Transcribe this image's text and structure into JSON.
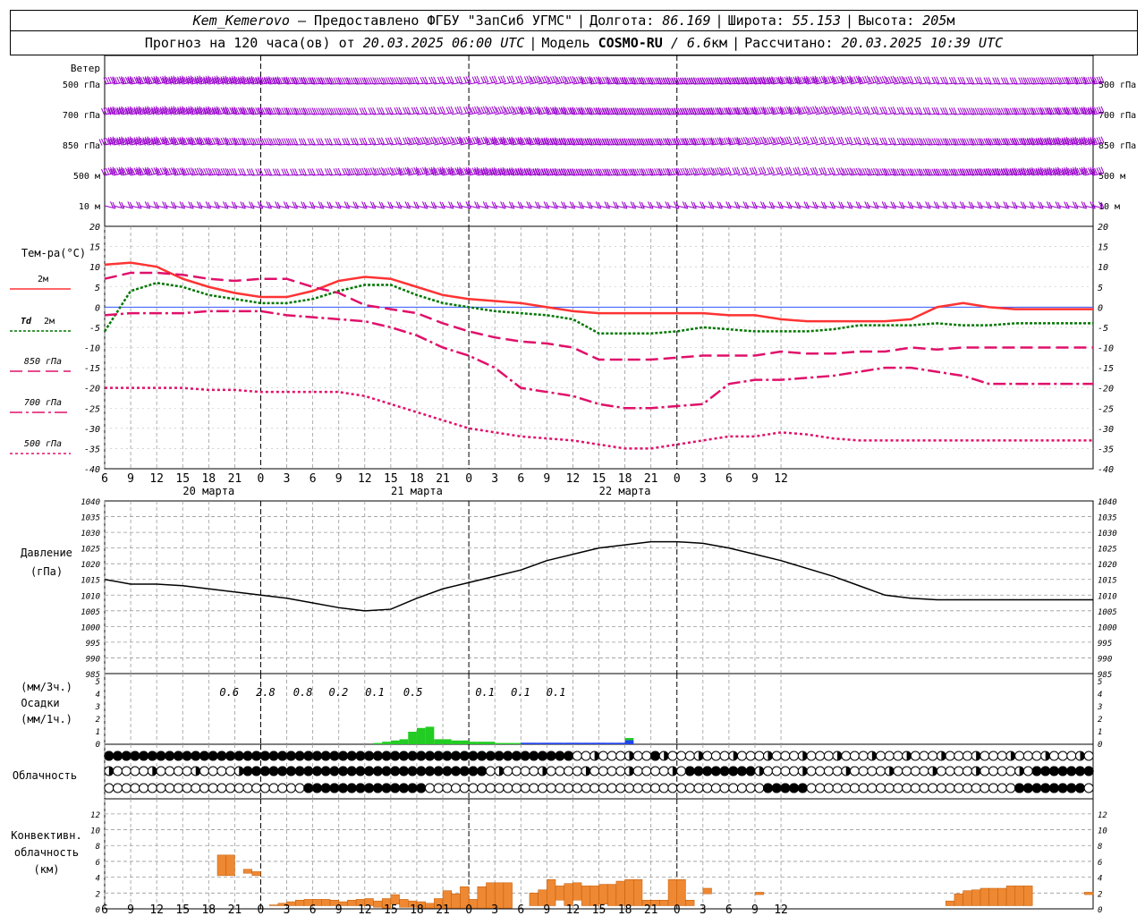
{
  "header": {
    "station": "Kem_Kemerovo",
    "provider": "— Предоставлено ФГБУ \"ЗапСиб УГМС\"",
    "lon_label": "Долгота:",
    "lon_value": "86.169",
    "lat_label": "Широта:",
    "lat_value": "55.153",
    "alt_label": "Высота:",
    "alt_value": "205",
    "alt_unit": "м",
    "forecast_label": "Прогноз на 120 часа(ов) от",
    "forecast_start": "20.03.2025 06:00 UTC",
    "model_label": "Модель",
    "model_name": "COSMO-RU",
    "model_res": "/ 6.6",
    "model_res_unit": "км",
    "calc_label": "Рассчитано:",
    "calc_time": "20.03.2025 10:39 UTC"
  },
  "colors": {
    "wind": "#9900cc",
    "t2m": "#ff3333",
    "td2m": "#007700",
    "t850": "#e0106a",
    "t700": "#e0106a",
    "t500": "#e0106a",
    "zero_line": "#3355ff",
    "pressure": "#000000",
    "precip_rain": "#22cc22",
    "precip_snow": "#2244ee",
    "convective": "#ee8833",
    "grid": "#999999"
  },
  "chart_data": [
    {
      "id": "wind",
      "type": "wind_barbs",
      "title": "Ветер",
      "levels": [
        "500 гПа",
        "700 гПа",
        "850 гПа",
        "500 м",
        "10 м"
      ],
      "time_ticks": [
        "6",
        "9",
        "12",
        "15",
        "18",
        "21",
        "0",
        "3",
        "6",
        "9",
        "12",
        "15",
        "18",
        "21",
        "0",
        "3",
        "6",
        "9",
        "12",
        "15",
        "18",
        "21",
        "0",
        "3",
        "6",
        "9",
        "12"
      ],
      "note": "barbs shown at hourly steps"
    },
    {
      "id": "temperature",
      "type": "line",
      "title": "Тем-ра(°C)",
      "x_hours": [
        0,
        3,
        6,
        9,
        12,
        15,
        18,
        21,
        24,
        27,
        30,
        33,
        36,
        39,
        42,
        45,
        48,
        51,
        54,
        57,
        60,
        63,
        66,
        69,
        72,
        75,
        78,
        81,
        84,
        87,
        90,
        93,
        96,
        99,
        102,
        105,
        108,
        111,
        114
      ],
      "ylim": [
        -40,
        20
      ],
      "yticks": [
        20,
        15,
        10,
        5,
        0,
        -5,
        -10,
        -15,
        -20,
        -25,
        -30,
        -35,
        -40
      ],
      "series": [
        {
          "name": "2м",
          "values": [
            10.5,
            11,
            10,
            7,
            5,
            3.5,
            2.5,
            2.5,
            4,
            6.5,
            7.5,
            7,
            5,
            3,
            2,
            1.5,
            1,
            0,
            -1,
            -1.5,
            -1.5,
            -1.5,
            -1.5,
            -1.5,
            -2,
            -2,
            -3,
            -3.5,
            -3.5,
            -3.5,
            -3.5,
            -3,
            0,
            1,
            0,
            -0.5,
            -0.5,
            -0.5,
            -0.5
          ]
        },
        {
          "name": "Td 2м",
          "values": [
            -6,
            4,
            6,
            5,
            3,
            2,
            1,
            1,
            2,
            4,
            5.5,
            5.5,
            3,
            1,
            0,
            -1,
            -1.5,
            -2,
            -3,
            -6.5,
            -6.5,
            -6.5,
            -6,
            -5,
            -5.5,
            -6,
            -6,
            -6,
            -5.5,
            -4.5,
            -4.5,
            -4.5,
            -4,
            -4.5,
            -4.5,
            -4,
            -4,
            -4,
            -4
          ]
        },
        {
          "name": "850 гПа",
          "values": [
            7,
            8.5,
            8.5,
            8,
            7,
            6.5,
            7,
            7,
            5,
            3.5,
            0.5,
            -0.5,
            -1.5,
            -4,
            -6,
            -7.5,
            -8.5,
            -9,
            -10,
            -13,
            -13,
            -13,
            -12.5,
            -12,
            -12,
            -12,
            -11,
            -11.5,
            -11.5,
            -11,
            -11,
            -10,
            -10.5,
            -10,
            -10,
            -10,
            -10,
            -10,
            -10
          ]
        },
        {
          "name": "700 гПа",
          "values": [
            -2,
            -1.5,
            -1.5,
            -1.5,
            -1,
            -1,
            -1,
            -2,
            -2.5,
            -3,
            -3.5,
            -5,
            -7,
            -10,
            -12,
            -15,
            -20,
            -21,
            -22,
            -24,
            -25,
            -25,
            -24.5,
            -24,
            -19,
            -18,
            -18,
            -17.5,
            -17,
            -16,
            -15,
            -15,
            -16,
            -17,
            -19,
            -19,
            -19,
            -19,
            -19
          ]
        },
        {
          "name": "500 гПа",
          "values": [
            -20,
            -20,
            -20,
            -20,
            -20.5,
            -20.5,
            -21,
            -21,
            -21,
            -21,
            -22,
            -24,
            -26,
            -28,
            -30,
            -31,
            -32,
            -32.5,
            -33,
            -34,
            -35,
            -35,
            -34,
            -33,
            -32,
            -32,
            -31,
            -31.5,
            -32.5,
            -33,
            -33,
            -33,
            -33,
            -33,
            -33,
            -33,
            -33,
            -33,
            -33
          ]
        }
      ]
    },
    {
      "id": "pressure",
      "type": "line",
      "title": "Давление",
      "ylabel": "(гПа)",
      "x_hours": [
        0,
        3,
        6,
        9,
        12,
        15,
        18,
        21,
        24,
        27,
        30,
        33,
        36,
        39,
        42,
        45,
        48,
        51,
        54,
        57,
        60,
        63,
        66,
        69,
        72,
        75,
        78,
        81,
        84,
        87,
        90,
        93,
        96,
        99,
        102,
        105,
        108,
        111,
        114
      ],
      "ylim": [
        985,
        1040
      ],
      "yticks": [
        1040,
        1035,
        1030,
        1025,
        1020,
        1015,
        1010,
        1005,
        1000,
        995,
        990,
        985
      ],
      "series": [
        {
          "name": "p",
          "values": [
            1015,
            1013.5,
            1013.5,
            1013,
            1012,
            1011,
            1010,
            1009,
            1007.5,
            1006,
            1005,
            1005.5,
            1009,
            1012,
            1014,
            1016,
            1018,
            1021,
            1023,
            1025,
            1026,
            1027,
            1027,
            1026.5,
            1025,
            1023,
            1021,
            1018.5,
            1016,
            1013,
            1010,
            1009,
            1008.5,
            1008.5,
            1008.5,
            1008.5,
            1008.5,
            1008.5,
            1008.5
          ]
        }
      ]
    },
    {
      "id": "precip",
      "type": "bar",
      "title": "Осадки",
      "ylabel_top": "(мм/3ч.)",
      "ylabel_bottom": "(мм/1ч.)",
      "yticks": [
        "5",
        "4",
        "3",
        "2",
        "1",
        "0"
      ],
      "totals_3h": [
        "0.6",
        "2.8",
        "0.8",
        "0.2",
        "0.1",
        "0.5",
        "0.1",
        "0.1",
        "0.1"
      ],
      "ylim": [
        0,
        5
      ],
      "rain_mm_per_hour": [
        0,
        0,
        0,
        0,
        0,
        0,
        0,
        0,
        0,
        0,
        0,
        0,
        0,
        0,
        0,
        0,
        0,
        0,
        0,
        0,
        0,
        0,
        0,
        0,
        0,
        0,
        0,
        0,
        0,
        0,
        0,
        0.1,
        0.2,
        0.3,
        0.4,
        1.0,
        1.3,
        1.4,
        0.4,
        0.4,
        0.3,
        0.3,
        0.2,
        0.2,
        0.2,
        0.1,
        0.1,
        0.1,
        0.05,
        0.05,
        0.05,
        0.05,
        0,
        0,
        0,
        0,
        0,
        0,
        0,
        0,
        0.5
      ],
      "snow_mm_per_hour": [
        0,
        0,
        0,
        0,
        0,
        0,
        0,
        0,
        0,
        0,
        0,
        0,
        0,
        0,
        0,
        0,
        0,
        0,
        0,
        0,
        0,
        0,
        0,
        0,
        0,
        0,
        0,
        0,
        0,
        0,
        0,
        0,
        0,
        0,
        0,
        0,
        0,
        0,
        0,
        0,
        0,
        0,
        0,
        0,
        0,
        0,
        0,
        0,
        0.05,
        0.05,
        0.05,
        0.05,
        0.05,
        0.05,
        0.05,
        0.05,
        0.05,
        0.05,
        0.05,
        0.05,
        0.25
      ]
    },
    {
      "id": "clouds",
      "type": "symbols",
      "title": "Облачность",
      "rows": 3
    },
    {
      "id": "convective",
      "type": "bar",
      "title": "Конвективн.",
      "title2": "облачность",
      "ylabel": "(км)",
      "ylim": [
        0,
        13
      ],
      "yticks": [
        12,
        10,
        8,
        6,
        4,
        2,
        0
      ],
      "bars_km": [
        {
          "from": 13,
          "to": 14,
          "base": 4.2,
          "top": 6.8
        },
        {
          "from": 14,
          "to": 15,
          "base": 4.2,
          "top": 6.8
        },
        {
          "from": 16,
          "to": 17,
          "base": 4.5,
          "top": 5.0
        },
        {
          "from": 17,
          "to": 18,
          "base": 4.2,
          "top": 4.7
        },
        {
          "from": 19,
          "to": 20,
          "base": 0.4,
          "top": 0.5
        },
        {
          "from": 20,
          "to": 21,
          "base": 0.4,
          "top": 0.7
        },
        {
          "from": 21,
          "to": 22,
          "base": 0.4,
          "top": 0.9
        },
        {
          "from": 22,
          "to": 23,
          "base": 0.4,
          "top": 1.1
        },
        {
          "from": 23,
          "to": 24,
          "base": 0.4,
          "top": 1.2
        },
        {
          "from": 24,
          "to": 25,
          "base": 0.4,
          "top": 1.2
        },
        {
          "from": 25,
          "to": 26,
          "base": 0.4,
          "top": 1.2
        },
        {
          "from": 26,
          "to": 27,
          "base": 0.4,
          "top": 1.1
        },
        {
          "from": 27,
          "to": 28,
          "base": 0.4,
          "top": 0.9
        },
        {
          "from": 28,
          "to": 29,
          "base": 0.4,
          "top": 1.1
        },
        {
          "from": 29,
          "to": 30,
          "base": 0.4,
          "top": 1.2
        },
        {
          "from": 30,
          "to": 31,
          "base": 0.4,
          "top": 1.3
        },
        {
          "from": 31,
          "to": 32,
          "base": 0.2,
          "top": 1.0
        },
        {
          "from": 32,
          "to": 33,
          "base": 0.1,
          "top": 1.3
        },
        {
          "from": 33,
          "to": 34,
          "base": 0.6,
          "top": 1.8
        },
        {
          "from": 34,
          "to": 35,
          "base": 0.2,
          "top": 1.2
        },
        {
          "from": 35,
          "to": 36,
          "base": 0.2,
          "top": 1.0
        },
        {
          "from": 36,
          "to": 37,
          "base": 0.1,
          "top": 0.9
        },
        {
          "from": 37,
          "to": 38,
          "base": 0.1,
          "top": 0.7
        },
        {
          "from": 38,
          "to": 39,
          "base": 0.1,
          "top": 1.3
        },
        {
          "from": 39,
          "to": 40,
          "base": 0.1,
          "top": 2.3
        },
        {
          "from": 40,
          "to": 41,
          "base": 0.1,
          "top": 1.9
        },
        {
          "from": 41,
          "to": 42,
          "base": 0.1,
          "top": 2.8
        },
        {
          "from": 42,
          "to": 43,
          "base": 0.1,
          "top": 1.2
        },
        {
          "from": 43,
          "to": 44,
          "base": 0.1,
          "top": 2.8
        },
        {
          "from": 44,
          "to": 45,
          "base": 0.1,
          "top": 3.3
        },
        {
          "from": 45,
          "to": 46,
          "base": 0.1,
          "top": 3.3
        },
        {
          "from": 46,
          "to": 47,
          "base": 0.1,
          "top": 3.3
        },
        {
          "from": 49,
          "to": 50,
          "base": 0.4,
          "top": 2.0
        },
        {
          "from": 50,
          "to": 51,
          "base": 0.4,
          "top": 2.4
        },
        {
          "from": 51,
          "to": 52,
          "base": 0.4,
          "top": 3.7
        },
        {
          "from": 52,
          "to": 53,
          "base": 1.1,
          "top": 2.9
        },
        {
          "from": 53,
          "to": 54,
          "base": 0.4,
          "top": 3.2
        },
        {
          "from": 54,
          "to": 55,
          "base": 1.1,
          "top": 3.3
        },
        {
          "from": 55,
          "to": 56,
          "base": 0.4,
          "top": 2.9
        },
        {
          "from": 56,
          "to": 57,
          "base": 0.4,
          "top": 2.9
        },
        {
          "from": 57,
          "to": 58,
          "base": 0.6,
          "top": 3.1
        },
        {
          "from": 58,
          "to": 59,
          "base": 0.4,
          "top": 3.1
        },
        {
          "from": 59,
          "to": 60,
          "base": 0.4,
          "top": 3.5
        },
        {
          "from": 60,
          "to": 61,
          "base": 0.4,
          "top": 3.7
        },
        {
          "from": 61,
          "to": 62,
          "base": 0.4,
          "top": 3.7
        },
        {
          "from": 62,
          "to": 63,
          "base": 0.4,
          "top": 1.1
        },
        {
          "from": 63,
          "to": 64,
          "base": 0.4,
          "top": 1.1
        },
        {
          "from": 64,
          "to": 65,
          "base": 0.4,
          "top": 1.1
        },
        {
          "from": 65,
          "to": 66,
          "base": 0.4,
          "top": 3.7
        },
        {
          "from": 66,
          "to": 67,
          "base": 0.4,
          "top": 3.7
        },
        {
          "from": 67,
          "to": 68,
          "base": 0.4,
          "top": 1.1
        },
        {
          "from": 69,
          "to": 70,
          "base": 1.9,
          "top": 2.6
        },
        {
          "from": 75,
          "to": 76,
          "base": 1.8,
          "top": 2.1
        },
        {
          "from": 97,
          "to": 98,
          "base": 0.4,
          "top": 1.0
        },
        {
          "from": 98,
          "to": 99,
          "base": 0.4,
          "top": 1.9
        },
        {
          "from": 99,
          "to": 100,
          "base": 0.4,
          "top": 2.3
        },
        {
          "from": 100,
          "to": 101,
          "base": 0.4,
          "top": 2.4
        },
        {
          "from": 101,
          "to": 102,
          "base": 0.4,
          "top": 2.6
        },
        {
          "from": 102,
          "to": 103,
          "base": 0.4,
          "top": 2.6
        },
        {
          "from": 103,
          "to": 104,
          "base": 0.4,
          "top": 2.6
        },
        {
          "from": 104,
          "to": 105,
          "base": 0.4,
          "top": 2.9
        },
        {
          "from": 105,
          "to": 106,
          "base": 0.4,
          "top": 2.9
        },
        {
          "from": 106,
          "to": 107,
          "base": 0.4,
          "top": 2.9
        },
        {
          "from": 113,
          "to": 114,
          "base": 1.8,
          "top": 2.1
        }
      ]
    }
  ],
  "axis": {
    "hour_labels": [
      "6",
      "9",
      "12",
      "15",
      "18",
      "21",
      "0",
      "3",
      "6",
      "9",
      "12",
      "15",
      "18",
      "21",
      "0",
      "3",
      "6",
      "9",
      "12",
      "15",
      "18",
      "21",
      "0",
      "3",
      "6",
      "9",
      "12"
    ],
    "date_labels": [
      "20 марта",
      "21 марта",
      "22 марта"
    ]
  },
  "legend": {
    "t2m": "2м",
    "td_symbol": "Td",
    "td2m": "2м",
    "t850": "850 гПа",
    "t700": "700 гПа",
    "t500": "500 гПа"
  }
}
